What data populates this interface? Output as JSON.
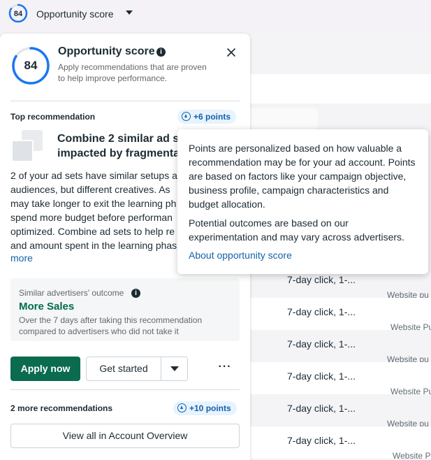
{
  "topbar": {
    "score": "84",
    "label": "Opportunity score"
  },
  "panel": {
    "score": "84",
    "title": "Opportunity score",
    "subtitle": "Apply recommendations that are proven to help improve performance.",
    "top_recommendation_label": "Top recommendation",
    "top_points": "+6 points",
    "recommendation": {
      "title_line1": "Combine 2 similar ad se",
      "title_line2": "impacted by fragmenta",
      "body_lines": [
        "2 of your ad sets have similar setups a",
        "audiences, but different creatives. As",
        "may take longer to exit the learning ph",
        "spend more budget before performan",
        "optimized. Combine ad sets to help re",
        "and amount spent in the learning phas"
      ],
      "more_link": "more"
    },
    "outcome": {
      "label": "Similar advertisers' outcome",
      "title": "More Sales",
      "description": "Over the 7 days after taking this recommendation compared to advertisers who did not take it"
    },
    "buttons": {
      "apply": "Apply now",
      "get_started": "Get started",
      "more": "···"
    },
    "more_recommendations": {
      "label": "2 more recommendations",
      "points": "+10 points"
    },
    "view_all": "View all in Account Overview"
  },
  "tooltip": {
    "paragraph1": "Points are personalized based on how valuable a recommendation may be for your ad account. Points are based on factors like your campaign objective, business profile, campaign characteristics and budget allocation.",
    "paragraph2": "Potential outcomes are based on our experimentation and may vary across advertisers.",
    "link": "About opportunity score"
  },
  "table": {
    "rows": [
      {
        "click": "7-day click, 1-...",
        "web": "Website pu"
      },
      {
        "click": "7-day click, 1-...",
        "web": "Website Pu"
      },
      {
        "click": "7-day click, 1-...",
        "web": "Website pu"
      },
      {
        "click": "7-day click, 1-...",
        "web": "Website Pu"
      },
      {
        "click": "7-day click, 1-...",
        "web": "Website pu"
      },
      {
        "click": "7-day click, 1-...",
        "web": "Website P"
      }
    ]
  },
  "colors": {
    "score_ring": "#1877f2",
    "apply_button": "#0a6b4f",
    "outcome_title": "#006b4e",
    "link": "#1461a8",
    "points_badge_bg": "#e7f3ff"
  }
}
